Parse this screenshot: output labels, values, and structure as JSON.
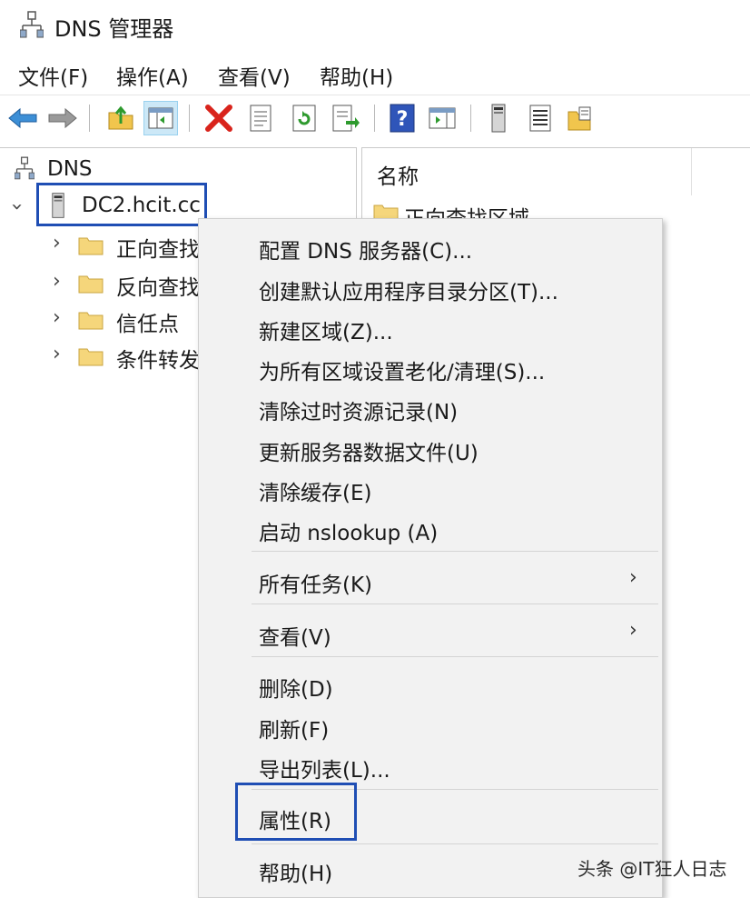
{
  "window": {
    "title": "DNS 管理器"
  },
  "menubar": [
    "文件(F)",
    "操作(A)",
    "查看(V)",
    "帮助(H)"
  ],
  "toolbar": {
    "icons": [
      "back-arrow-icon",
      "forward-arrow-icon",
      "up-folder-icon",
      "show-hide-console-tree-icon",
      "delete-icon",
      "properties-icon",
      "refresh-icon",
      "export-list-icon",
      "help-icon",
      "show-hide-action-pane-icon",
      "server-icon",
      "list-icon",
      "zone-icon"
    ]
  },
  "tree": {
    "root": "DNS",
    "server": "DC2.hcit.cc",
    "children": [
      "正向查找",
      "反向查找",
      "信任点",
      "条件转发"
    ]
  },
  "list": {
    "column_name": "名称",
    "first_item": "正向查找区域"
  },
  "context_menu": {
    "groups": [
      [
        "配置 DNS 服务器(C)...",
        "创建默认应用程序目录分区(T)...",
        "新建区域(Z)...",
        "为所有区域设置老化/清理(S)...",
        "清除过时资源记录(N)",
        "更新服务器数据文件(U)",
        "清除缓存(E)",
        "启动 nslookup (A)"
      ],
      [
        "所有任务(K)"
      ],
      [
        "查看(V)"
      ],
      [
        "删除(D)",
        "刷新(F)",
        "导出列表(L)..."
      ],
      [
        "属性(R)"
      ],
      [
        "帮助(H)"
      ]
    ],
    "submenu_marker": "›"
  },
  "watermark": "头条 @IT狂人日志",
  "colors": {
    "highlight": "#1f4eb4",
    "menu_bg": "#f2f2f2",
    "folder": "#f5d67b"
  }
}
